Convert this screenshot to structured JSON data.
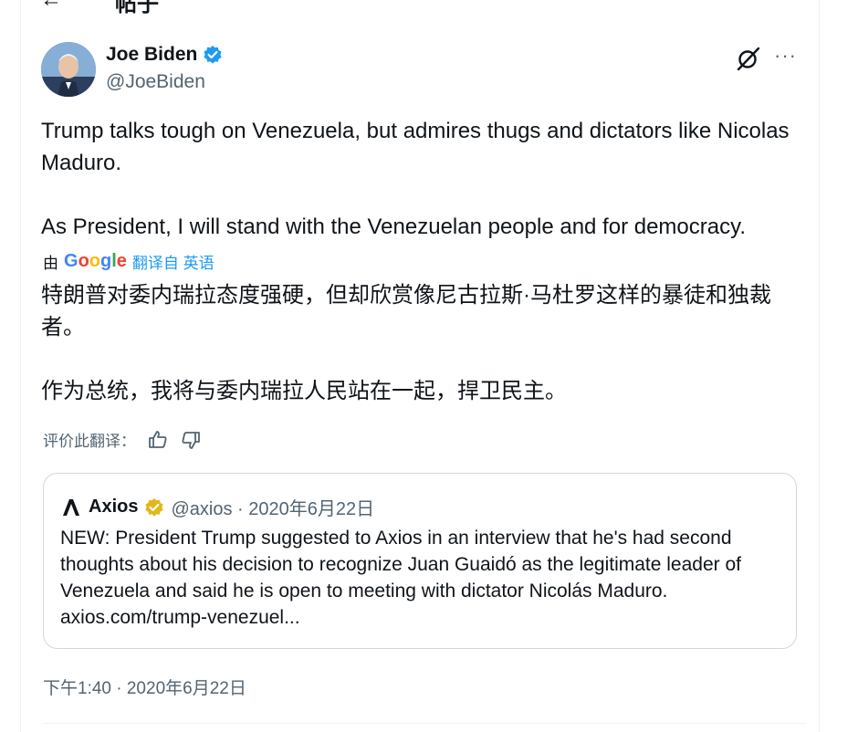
{
  "header": {
    "back_icon": "arrow-left-icon",
    "title": "帖子"
  },
  "author": {
    "name": "Joe Biden",
    "handle": "@JoeBiden",
    "verified_color": "#1d9bf0",
    "avatar_icon": "user-avatar"
  },
  "actions": {
    "grok_icon": "grok-icon",
    "more_label": "···"
  },
  "tweet": {
    "text": "Trump talks tough on Venezuela, but admires thugs and dictators like Nicolas Maduro.\n\nAs President, I will stand with the Venezuelan people and for democracy."
  },
  "translation": {
    "by_prefix": "由",
    "provider": "Google",
    "from_label": "翻译自 英语",
    "text": "特朗普对委内瑞拉态度强硬，但却欣赏像尼古拉斯·马杜罗这样的暴徒和独裁者。\n\n作为总统，我将与委内瑞拉人民站在一起，捍卫民主。",
    "rate_label": "评价此翻译：",
    "thumb_up_icon": "thumb-up-icon",
    "thumb_down_icon": "thumb-down-icon"
  },
  "quote": {
    "name": "Axios",
    "meta": "@axios · 2020年6月22日",
    "verified_color": "#e2b719",
    "text": "NEW: President Trump suggested to Axios in an interview that he's had second thoughts about his decision to recognize Juan Guaidó as the legitimate leader of Venezuela and said he is open to meeting with dictator Nicolás Maduro. axios.com/trump-venezuel..."
  },
  "timestamp": "下午1:40 · 2020年6月22日",
  "colors": {
    "accent": "#1d9bf0",
    "secondary_text": "#536471",
    "border": "#cfd9de"
  }
}
